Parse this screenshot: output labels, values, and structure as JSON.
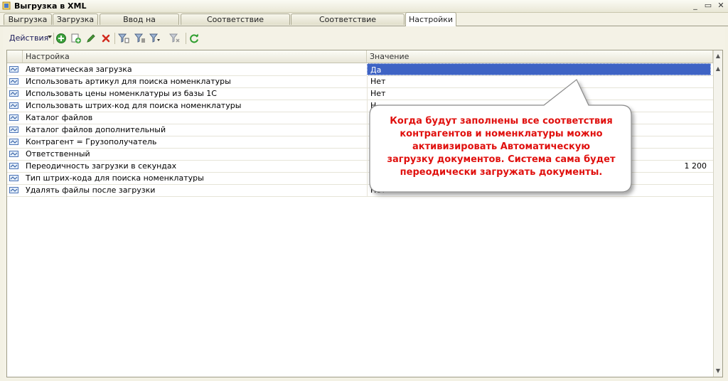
{
  "window": {
    "title": "Выгрузка  в XML",
    "controls": [
      "_",
      "▭",
      "✕"
    ]
  },
  "tabs": [
    {
      "label": "Выгрузка"
    },
    {
      "label": "Загрузка"
    },
    {
      "label": "Ввод на основании"
    },
    {
      "label": "Соответствие контрагентов"
    },
    {
      "label": "Соответствие номенклатуры"
    },
    {
      "label": "Настройки",
      "active": true
    }
  ],
  "toolbar": {
    "actions_label": "Действия",
    "icons": [
      "add-icon",
      "copy-icon",
      "edit-icon",
      "delete-icon",
      "filter-icon",
      "filter-list-icon",
      "filter-dropdown-icon",
      "clear-filter-icon",
      "refresh-icon"
    ]
  },
  "grid": {
    "columns": [
      "Настройка",
      "Значение"
    ],
    "rows": [
      {
        "name": "Автоматическая загрузка",
        "value": "Да"
      },
      {
        "name": "Использовать артикул для поиска номенклатуры",
        "value": "Нет"
      },
      {
        "name": "Использовать цены номенклатуры из базы 1С",
        "value": "Нет"
      },
      {
        "name": "Использовать штрих-код для поиска номенклатуры",
        "value": "Н"
      },
      {
        "name": "Каталог файлов",
        "value": ""
      },
      {
        "name": "Каталог файлов дополнительный",
        "value": ""
      },
      {
        "name": "Контрагент = Грузополучатель",
        "value": ""
      },
      {
        "name": "Ответственный",
        "value": ""
      },
      {
        "name": "Переодичность загрузки в секундах",
        "value": "1 200"
      },
      {
        "name": "Тип штрих-кода для поиска номенклатуры",
        "value": ""
      },
      {
        "name": "Удалять файлы после загрузки",
        "value": "Нет"
      }
    ]
  },
  "callout": {
    "lines": [
      "Когда будут заполнены все соответствия",
      "контрагентов и номенклатуры можно",
      "активизировать Автоматическую",
      "загрузку документов. Система сама будет",
      "переодически загружать документы."
    ]
  },
  "colors": {
    "selection": "#3e63c4",
    "callout_text": "#e0100e",
    "accent_green": "#2f9e2f"
  }
}
